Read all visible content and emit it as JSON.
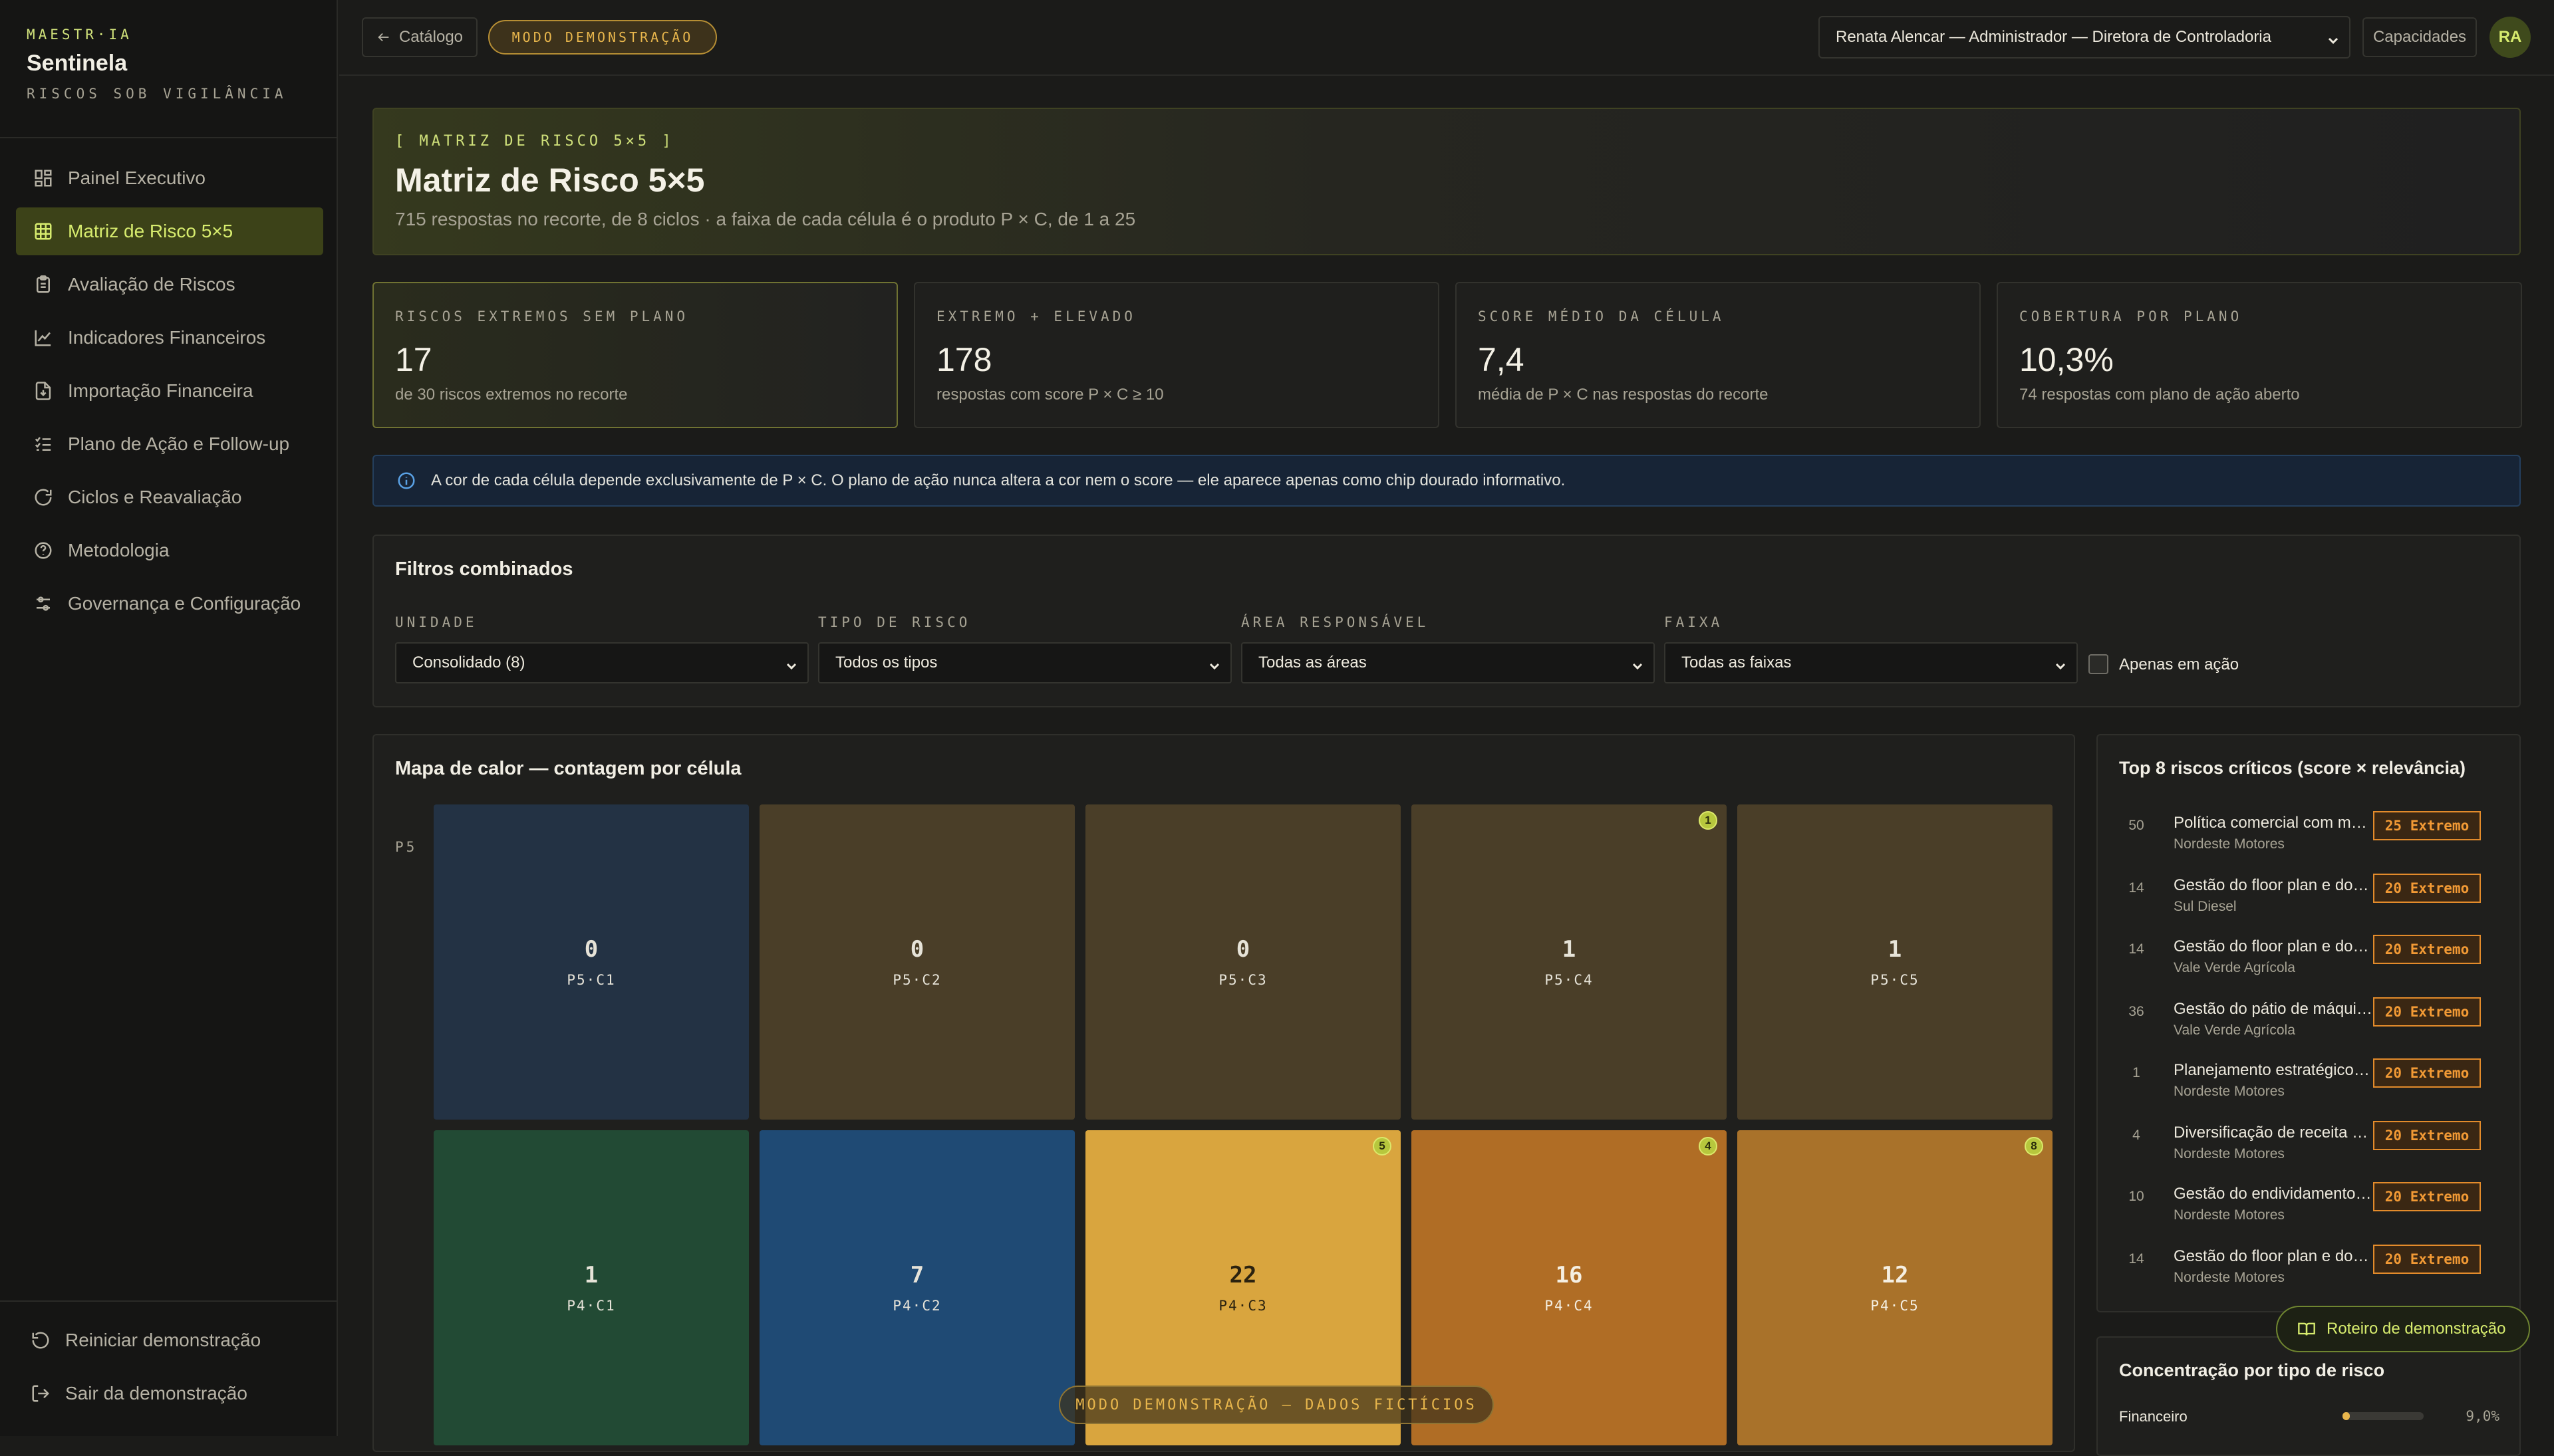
{
  "brand": {
    "small": "MAESTR·IA",
    "name": "Sentinela",
    "tagline": "RISCOS SOB VIGILÂNCIA"
  },
  "nav": [
    {
      "label": "Painel Executivo",
      "icon": "dashboard-icon"
    },
    {
      "label": "Matriz de Risco 5×5",
      "icon": "grid-icon",
      "active": true
    },
    {
      "label": "Avaliação de Riscos",
      "icon": "clipboard-icon"
    },
    {
      "label": "Indicadores Financeiros",
      "icon": "line-chart-icon"
    },
    {
      "label": "Importação Financeira",
      "icon": "file-import-icon"
    },
    {
      "label": "Plano de Ação e Follow-up",
      "icon": "checklist-icon"
    },
    {
      "label": "Ciclos e Reavaliação",
      "icon": "refresh-icon"
    },
    {
      "label": "Metodologia",
      "icon": "help-circle-icon"
    },
    {
      "label": "Governança e Configuração",
      "icon": "sliders-icon"
    }
  ],
  "side_bottom": {
    "reset": "Reiniciar demonstração",
    "exit": "Sair da demonstração"
  },
  "topbar": {
    "back": "Catálogo",
    "demo_badge": "MODO DEMONSTRAÇÃO",
    "user": "Renata Alencar — Administrador — Diretora de Controladoria",
    "capabilities": "Capacidades",
    "avatar": "RA"
  },
  "hero": {
    "tag": "[ MATRIZ DE RISCO 5×5 ]",
    "title": "Matriz de Risco 5×5",
    "subtitle": "715 respostas no recorte, de 8 ciclos · a faixa de cada célula é o produto P × C, de 1 a 25"
  },
  "kpis": [
    {
      "label": "RISCOS EXTREMOS SEM PLANO",
      "value": "17",
      "sub": "de 30 riscos extremos no recorte"
    },
    {
      "label": "EXTREMO + ELEVADO",
      "value": "178",
      "sub": "respostas com score P × C ≥ 10"
    },
    {
      "label": "SCORE MÉDIO DA CÉLULA",
      "value": "7,4",
      "sub": "média de P × C nas respostas do recorte"
    },
    {
      "label": "COBERTURA POR PLANO",
      "value": "10,3%",
      "sub": "74 respostas com plano de ação aberto"
    }
  ],
  "info": "A cor de cada célula depende exclusivamente de P  ×  C. O plano de ação nunca altera a cor nem o score — ele aparece apenas como chip dourado informativo.",
  "filters": {
    "title": "Filtros combinados",
    "items": [
      {
        "label": "UNIDADE",
        "value": "Consolidado (8)"
      },
      {
        "label": "TIPO DE RISCO",
        "value": "Todos os tipos"
      },
      {
        "label": "ÁREA RESPONSÁVEL",
        "value": "Todas as áreas"
      },
      {
        "label": "FAIXA",
        "value": "Todas as faixas"
      }
    ],
    "only_action": "Apenas em ação"
  },
  "heatmap": {
    "title": "Mapa de calor — contagem por célula",
    "rows": [
      {
        "label": "P5",
        "cells": [
          {
            "count": "0",
            "code": "P5·C1",
            "bg": "#233244",
            "fg": "#e6e3d8",
            "chip": ""
          },
          {
            "count": "0",
            "code": "P5·C2",
            "bg": "#4a3e28",
            "fg": "#e6e3d8",
            "chip": ""
          },
          {
            "count": "0",
            "code": "P5·C3",
            "bg": "#4a3e28",
            "fg": "#e6e3d8",
            "chip": ""
          },
          {
            "count": "1",
            "code": "P5·C4",
            "bg": "#4a3e28",
            "fg": "#e6e3d8",
            "chip": "1"
          },
          {
            "count": "1",
            "code": "P5·C5",
            "bg": "#4a3e28",
            "fg": "#e6e3d8",
            "chip": ""
          }
        ]
      },
      {
        "label": "",
        "cells": [
          {
            "count": "1",
            "code": "P4·C1",
            "bg": "#224a34",
            "fg": "#e6e3d8",
            "chip": ""
          },
          {
            "count": "7",
            "code": "P4·C2",
            "bg": "#1f4a74",
            "fg": "#e6e3d8",
            "chip": ""
          },
          {
            "count": "22",
            "code": "P4·C3",
            "bg": "#d9a53e",
            "fg": "#2b220f",
            "chip": "5"
          },
          {
            "count": "16",
            "code": "P4·C4",
            "bg": "#b06d25",
            "fg": "#f5efe2",
            "chip": "4"
          },
          {
            "count": "12",
            "code": "P4·C5",
            "bg": "#a9722a",
            "fg": "#f5efe2",
            "chip": "8"
          }
        ]
      }
    ]
  },
  "top8": {
    "title": "Top 8 riscos críticos (score × relevância)",
    "items": [
      {
        "idx": "50",
        "name": "Política comercial com margem negativa",
        "unit": "Nordeste Motores",
        "badge": "25 Extremo"
      },
      {
        "idx": "14",
        "name": "Gestão do floor plan e do estoque",
        "unit": "Sul Diesel",
        "badge": "20 Extremo"
      },
      {
        "idx": "14",
        "name": "Gestão do floor plan e do estoque",
        "unit": "Vale Verde Agrícola",
        "badge": "20 Extremo"
      },
      {
        "idx": "36",
        "name": "Gestão do pátio de máquinas usadas",
        "unit": "Vale Verde Agrícola",
        "badge": "20 Extremo"
      },
      {
        "idx": "1",
        "name": "Planejamento estratégico e orçamento",
        "unit": "Nordeste Motores",
        "badge": "20 Extremo"
      },
      {
        "idx": "4",
        "name": "Diversificação de receita e serviços",
        "unit": "Nordeste Motores",
        "badge": "20 Extremo"
      },
      {
        "idx": "10",
        "name": "Gestão do endividamento bancário",
        "unit": "Nordeste Motores",
        "badge": "20 Extremo"
      },
      {
        "idx": "14",
        "name": "Gestão do floor plan e do estoque",
        "unit": "Nordeste Motores",
        "badge": "20 Extremo"
      }
    ]
  },
  "concentration": {
    "title": "Concentração por tipo de risco",
    "items": [
      {
        "label": "Financeiro",
        "value": "9,0%",
        "fraction": 0.09
      }
    ]
  },
  "floating": {
    "roteiro": "Roteiro de demonstração",
    "watermark": "MODO DEMONSTRAÇÃO — DADOS FICTÍCIOS"
  },
  "colors": {
    "accent": "#d7ec6e",
    "demo": "#e8b64c",
    "extreme": "#f29a35"
  }
}
